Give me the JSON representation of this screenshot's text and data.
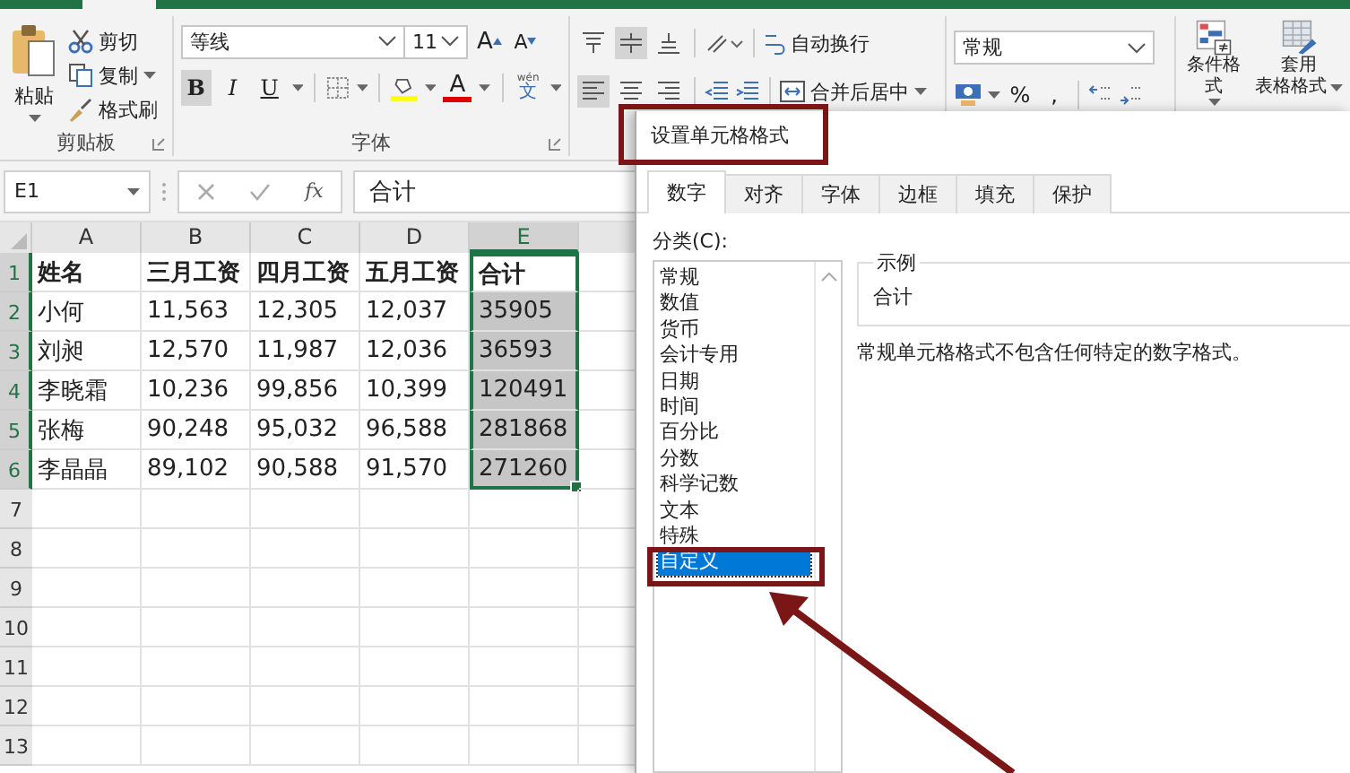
{
  "ribbon": {
    "clipboard": {
      "paste": "粘贴",
      "cut": "剪切",
      "copy": "复制",
      "format_painter": "格式刷",
      "group_label": "剪贴板"
    },
    "font": {
      "font_name": "等线",
      "font_size": "11",
      "grow": "A",
      "shrink": "A",
      "styles": [
        {
          "label": "B",
          "kind": "bold",
          "selected": true
        },
        {
          "label": "I",
          "kind": "italic",
          "selected": false
        },
        {
          "label": "U",
          "kind": "underline",
          "selected": false
        }
      ],
      "font_color": "A",
      "phonetic_top": "wén",
      "phonetic_bottom": "文",
      "group_label": "字体"
    },
    "alignment": {
      "vertical": [
        {
          "selected": false
        },
        {
          "selected": true
        },
        {
          "selected": false
        }
      ],
      "horizontal": [
        {
          "selected": true
        },
        {
          "selected": false
        },
        {
          "selected": false
        }
      ],
      "wrap": "自动换行",
      "merge": "合并后居中"
    },
    "number": {
      "format": "常规",
      "percent": "%",
      "comma": ","
    },
    "styles": {
      "conditional": "条件格式",
      "table_line1": "套用",
      "table_line2": "表格格式"
    }
  },
  "formula_bar": {
    "name_box": "E1",
    "fx": "fx",
    "value": "合计"
  },
  "sheet": {
    "columns": [
      {
        "label": "A",
        "selected": false
      },
      {
        "label": "B",
        "selected": false
      },
      {
        "label": "C",
        "selected": false
      },
      {
        "label": "D",
        "selected": false
      },
      {
        "label": "E",
        "selected": true
      }
    ],
    "rows": [
      {
        "number": "1",
        "selected": true,
        "cells": [
          "姓名",
          "三月工资",
          "四月工资",
          "五月工资",
          "合计"
        ]
      },
      {
        "number": "2",
        "selected": true,
        "cells": [
          "小何",
          "11,563",
          "12,305",
          "12,037",
          "35905"
        ]
      },
      {
        "number": "3",
        "selected": true,
        "cells": [
          "刘昶",
          "12,570",
          "11,987",
          "12,036",
          "36593"
        ]
      },
      {
        "number": "4",
        "selected": true,
        "cells": [
          "李晓霜",
          "10,236",
          "99,856",
          "10,399",
          "120491"
        ]
      },
      {
        "number": "5",
        "selected": true,
        "cells": [
          "张梅",
          "90,248",
          "95,032",
          "96,588",
          "281868"
        ]
      },
      {
        "number": "6",
        "selected": true,
        "cells": [
          "李晶晶",
          "89,102",
          "90,588",
          "91,570",
          "271260"
        ]
      },
      {
        "number": "7",
        "selected": false,
        "cells": []
      },
      {
        "number": "8",
        "selected": false,
        "cells": []
      },
      {
        "number": "9",
        "selected": false,
        "cells": []
      },
      {
        "number": "10",
        "selected": false,
        "cells": []
      },
      {
        "number": "11",
        "selected": false,
        "cells": []
      },
      {
        "number": "12",
        "selected": false,
        "cells": []
      },
      {
        "number": "13",
        "selected": false,
        "cells": []
      }
    ]
  },
  "dialog": {
    "title": "设置单元格格式",
    "tabs": [
      {
        "label": "数字",
        "selected": true
      },
      {
        "label": "对齐",
        "selected": false
      },
      {
        "label": "字体",
        "selected": false
      },
      {
        "label": "边框",
        "selected": false
      },
      {
        "label": "填充",
        "selected": false
      },
      {
        "label": "保护",
        "selected": false
      }
    ],
    "category_label": "分类(C):",
    "categories": [
      {
        "label": "常规",
        "selected": false
      },
      {
        "label": "数值",
        "selected": false
      },
      {
        "label": "货币",
        "selected": false
      },
      {
        "label": "会计专用",
        "selected": false
      },
      {
        "label": "日期",
        "selected": false
      },
      {
        "label": "时间",
        "selected": false
      },
      {
        "label": "百分比",
        "selected": false
      },
      {
        "label": "分数",
        "selected": false
      },
      {
        "label": "科学记数",
        "selected": false
      },
      {
        "label": "文本",
        "selected": false
      },
      {
        "label": "特殊",
        "selected": false
      },
      {
        "label": "自定义",
        "selected": true
      }
    ],
    "sample_label": "示例",
    "sample_value": "合计",
    "description": "常规单元格格式不包含任何特定的数字格式。"
  }
}
